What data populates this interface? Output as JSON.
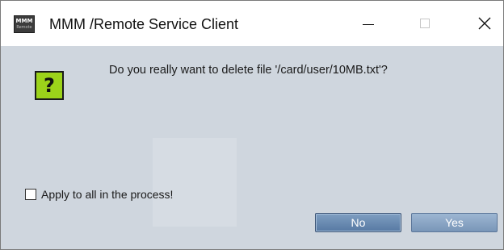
{
  "window": {
    "icon_text": "MMM",
    "icon_subtext": "Remote",
    "title": "MMM /Remote Service Client",
    "controls": {
      "minimize": "minimize-icon",
      "maximize": "maximize-icon",
      "close": "close-icon"
    }
  },
  "dialog": {
    "icon_glyph": "?",
    "message": "Do you really want to delete file '/card/user/10MB.txt'?",
    "checkbox_label": "Apply to all in the process!",
    "checkbox_checked": false,
    "buttons": {
      "no": "No",
      "yes": "Yes"
    }
  },
  "colors": {
    "client_bg": "#cfd6de",
    "question_icon_bg": "#9cd31a",
    "button_no": "#5779a3",
    "button_yes": "#7996b8"
  }
}
